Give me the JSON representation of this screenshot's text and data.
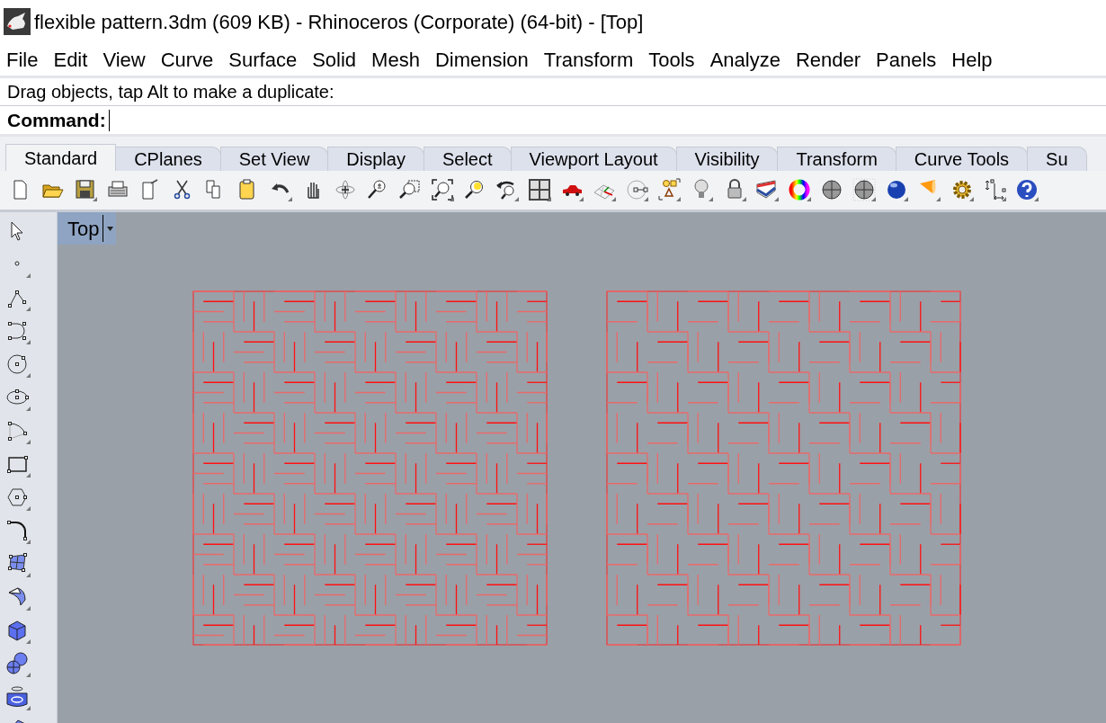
{
  "window": {
    "title": "flexible pattern.3dm (609 KB) - Rhinoceros (Corporate) (64-bit) - [Top]"
  },
  "menu": [
    "File",
    "Edit",
    "View",
    "Curve",
    "Surface",
    "Solid",
    "Mesh",
    "Dimension",
    "Transform",
    "Tools",
    "Analyze",
    "Render",
    "Panels",
    "Help"
  ],
  "command_area": {
    "prompt": "Drag objects, tap Alt to make a duplicate:",
    "label": "Command:"
  },
  "tabs": [
    {
      "label": "Standard",
      "selected": true
    },
    {
      "label": "CPlanes",
      "selected": false
    },
    {
      "label": "Set View",
      "selected": false
    },
    {
      "label": "Display",
      "selected": false
    },
    {
      "label": "Select",
      "selected": false
    },
    {
      "label": "Viewport Layout",
      "selected": false
    },
    {
      "label": "Visibility",
      "selected": false
    },
    {
      "label": "Transform",
      "selected": false
    },
    {
      "label": "Curve Tools",
      "selected": false
    },
    {
      "label": "Su",
      "selected": false
    }
  ],
  "viewport": {
    "title": "Top"
  }
}
